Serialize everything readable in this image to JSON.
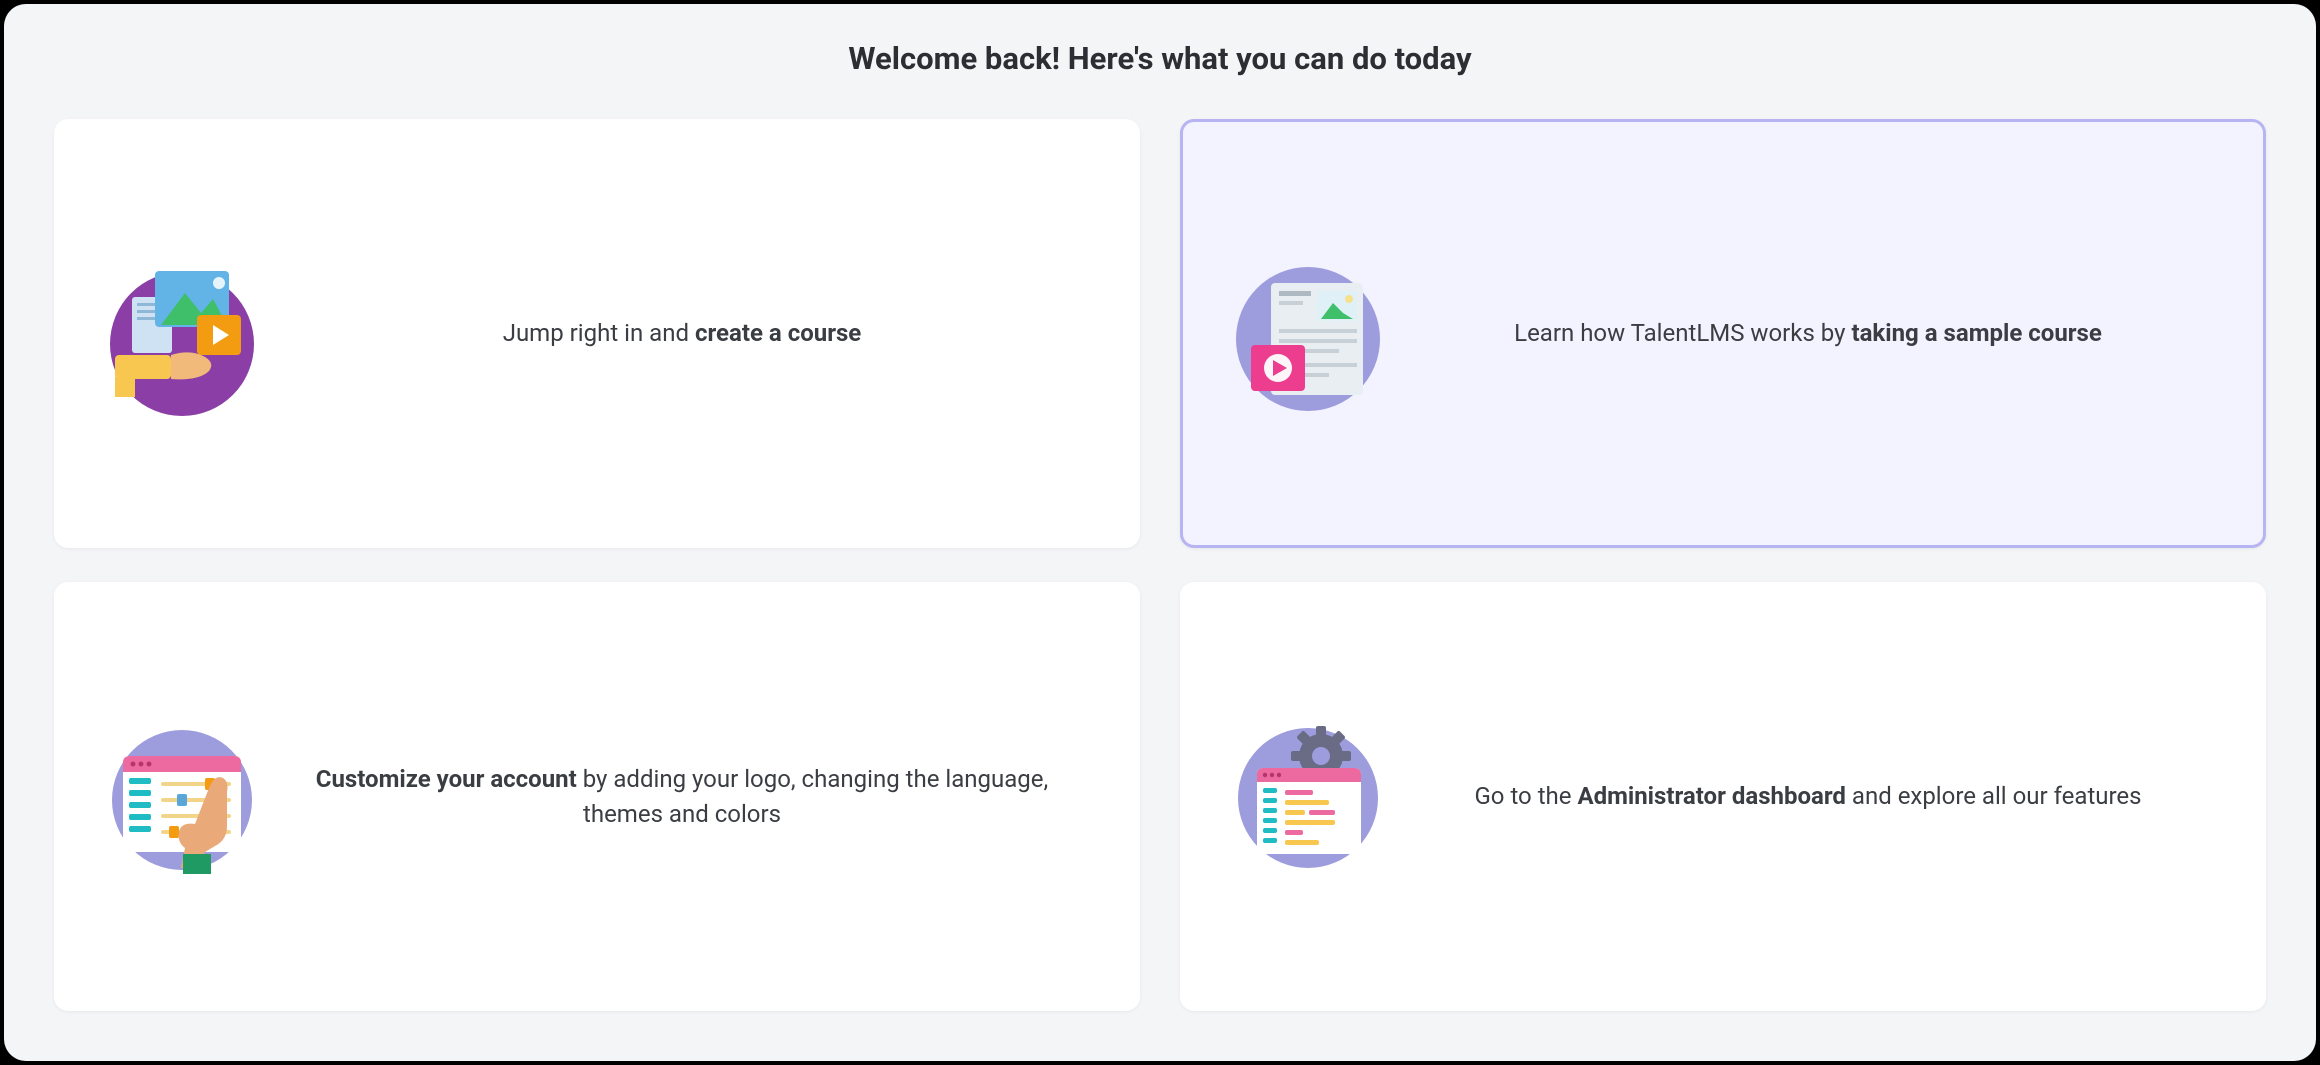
{
  "header": {
    "title": "Welcome back! Here's what you can do today"
  },
  "cards": [
    {
      "id": "create-course",
      "icon": "create-course-icon",
      "text_pre": "Jump right in and ",
      "text_bold": "create a course",
      "text_post": "",
      "highlighted": false
    },
    {
      "id": "sample-course",
      "icon": "sample-course-icon",
      "text_pre": "Learn how TalentLMS works by ",
      "text_bold": "taking a sample course",
      "text_post": "",
      "highlighted": true
    },
    {
      "id": "customize-account",
      "icon": "customize-account-icon",
      "text_pre": "",
      "text_bold": "Customize your account",
      "text_post": " by adding your logo, changing the language, themes and colors",
      "highlighted": false
    },
    {
      "id": "admin-dashboard",
      "icon": "admin-dashboard-icon",
      "text_pre": "Go to the ",
      "text_bold": "Administrator dashboard",
      "text_post": " and explore all our features",
      "highlighted": false
    }
  ],
  "colors": {
    "panel_bg": "#f4f5f6",
    "card_bg": "#ffffff",
    "highlight_border": "#b6b4f2",
    "highlight_bg": "#f3f2ff",
    "text": "#3a3d42",
    "purple": "#8b3fa6",
    "lavender": "#9d9cdd",
    "pink": "#ec3d8f",
    "orange": "#f39c12",
    "teal": "#1fbcc4",
    "yellow": "#f7c74f",
    "green": "#3fbf6a",
    "blue": "#63b4e6"
  }
}
